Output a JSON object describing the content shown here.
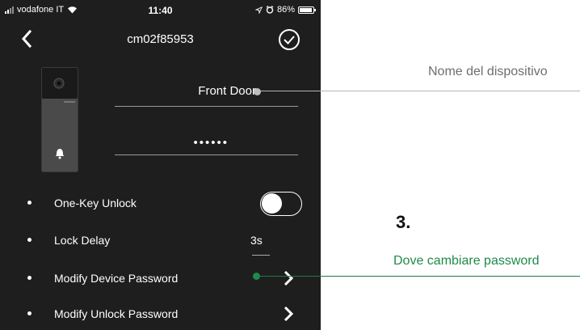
{
  "status_bar": {
    "carrier": "vodafone IT",
    "time": "11:40",
    "battery": "86%"
  },
  "nav": {
    "title": "cm02f85953",
    "back_icon": "chevron-left-icon",
    "confirm_icon": "check-circle-icon"
  },
  "device": {
    "name_value": "Front Door",
    "password_value": "••••••"
  },
  "settings": {
    "one_key_unlock": {
      "label": "One-Key Unlock",
      "enabled": false
    },
    "lock_delay": {
      "label": "Lock Delay",
      "value": "3s"
    },
    "modify_device_password": {
      "label": "Modify Device Password"
    },
    "modify_unlock_password": {
      "label": "Modify Unlock Password"
    }
  },
  "annotations": {
    "device_name": "Nome del dispositivo",
    "step": "3.",
    "change_password": "Dove cambiare password"
  },
  "colors": {
    "phone_bg": "#1e1e1e",
    "accent_green": "#1f8a4c",
    "annotation_gray": "#6e6e6e"
  }
}
